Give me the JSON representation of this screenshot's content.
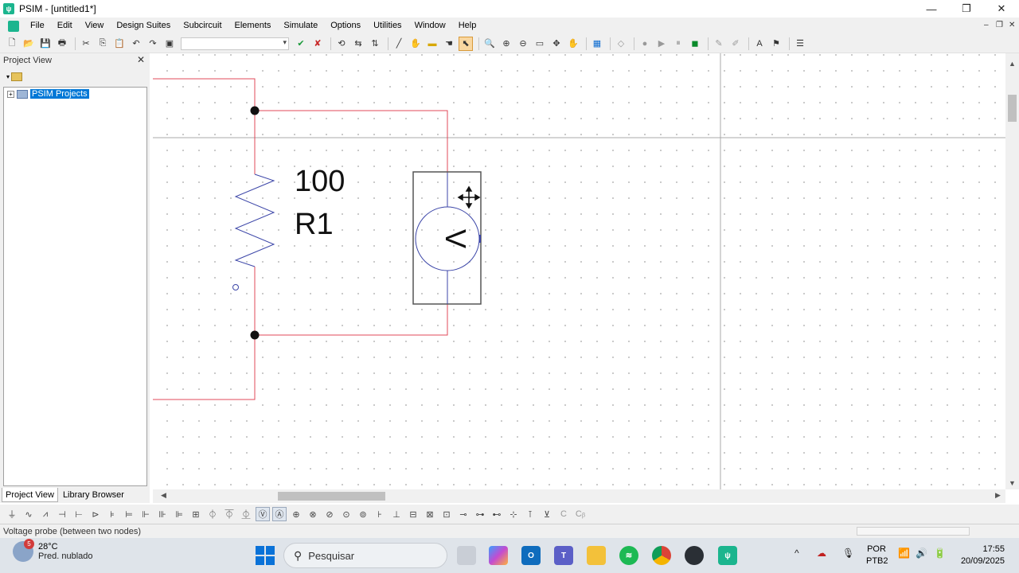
{
  "window": {
    "title": "PSIM - [untitled1*]",
    "app_icon": "psim-icon",
    "controls": {
      "minimize": "—",
      "maximize": "❐",
      "close": "✕"
    }
  },
  "menu": {
    "items": [
      "File",
      "Edit",
      "View",
      "Design Suites",
      "Subcircuit",
      "Elements",
      "Simulate",
      "Options",
      "Utilities",
      "Window",
      "Help"
    ],
    "mdi_controls": {
      "minimize": "‒",
      "restore": "❐",
      "close": "✕"
    }
  },
  "toolbar": {
    "combo_value": "",
    "icons": [
      "new-file-icon",
      "open-folder-icon",
      "save-icon",
      "print-icon",
      "cut-icon",
      "copy-icon",
      "paste-icon",
      "undo-icon",
      "redo-icon",
      "clipboard-icon",
      "check-icon",
      "cancel-icon",
      "rotate-icon",
      "flip-icon",
      "flip-icon",
      "wire-icon",
      "hand-icon",
      "label-icon",
      "pan-icon",
      "select-icon",
      "zoom-icon",
      "zoom-in-icon",
      "zoom-out-icon",
      "fit-page-icon",
      "pan-icon",
      "hand-icon",
      "element-icon",
      "diamond-icon",
      "stop-icon",
      "run-icon",
      "pause-icon",
      "simview-icon",
      "draw-icon",
      "draw-icon",
      "text-icon",
      "probe-icon",
      "lib-icon"
    ]
  },
  "panel": {
    "header": "Project View",
    "close": "✕",
    "tree": {
      "expander": "+",
      "root_label": "PSIM Projects"
    },
    "tabs": [
      "Project View",
      "Library Browser"
    ]
  },
  "schematic": {
    "resistor_value": "100",
    "resistor_label": "R1",
    "voltmeter_symbol": "V"
  },
  "status": {
    "text": "Voltage probe (between two nodes)"
  },
  "taskbar": {
    "weather_badge": "5",
    "weather_temp": "28°C",
    "weather_desc": "Pred. nublado",
    "search_placeholder": "Pesquisar",
    "lang1": "POR",
    "lang2": "PTB2",
    "time": "17:55",
    "date": "20/09/2025"
  },
  "colors": {
    "wire": "#e04a5a",
    "component": "#3c46a8",
    "accent": "#0078d7",
    "psim_green": "#1bb58e"
  }
}
